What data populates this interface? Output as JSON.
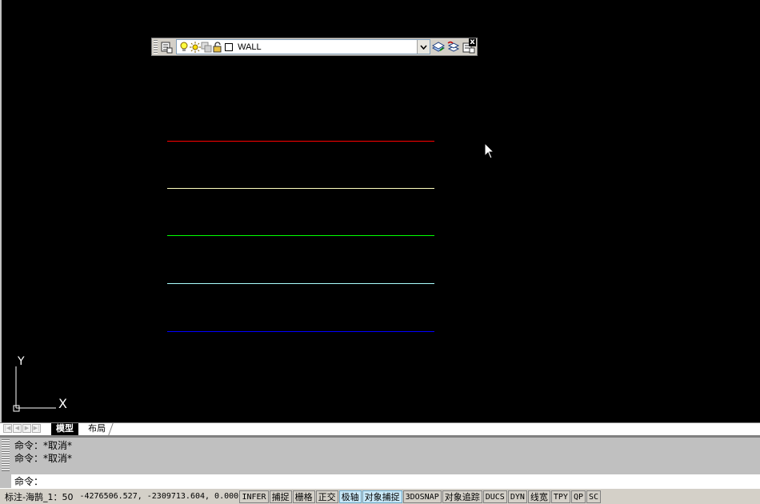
{
  "layer_toolbar": {
    "layer_name": "WALL",
    "icons": [
      "layer-manager-icon",
      "bulb-icon",
      "sun-icon",
      "viewport-freeze-icon",
      "lock-icon",
      "color-swatch-icon",
      "dropdown-arrow-icon",
      "make-current-icon",
      "layer-previous-icon",
      "layer-states-icon",
      "close-icon"
    ],
    "close_label": "x"
  },
  "drawing": {
    "line_colors": [
      "#ff0000",
      "#ffffc0",
      "#00ff00",
      "#aaffff",
      "#0000ff"
    ]
  },
  "ucs": {
    "y_label": "Y",
    "x_label": "X"
  },
  "tabs": {
    "model": "模型",
    "layout": "布局"
  },
  "command": {
    "history": [
      "命令：*取消*",
      "命令：*取消*"
    ],
    "prompt": "命令："
  },
  "status": {
    "annotation": "标注-海鹄_1：50",
    "coords": "-4276506.527, -2309713.604, 0.000",
    "toggles": [
      {
        "label": "INFER",
        "on": false
      },
      {
        "label": "捕捉",
        "on": false
      },
      {
        "label": "栅格",
        "on": false
      },
      {
        "label": "正交",
        "on": false
      },
      {
        "label": "极轴",
        "on": true
      },
      {
        "label": "对象捕捉",
        "on": true
      },
      {
        "label": "3DOSNAP",
        "on": false
      },
      {
        "label": "对象追踪",
        "on": false
      },
      {
        "label": "DUCS",
        "on": false
      },
      {
        "label": "DYN",
        "on": false
      },
      {
        "label": "线宽",
        "on": false
      },
      {
        "label": "TPY",
        "on": false
      },
      {
        "label": "QP",
        "on": false
      },
      {
        "label": "SC",
        "on": false
      }
    ]
  }
}
